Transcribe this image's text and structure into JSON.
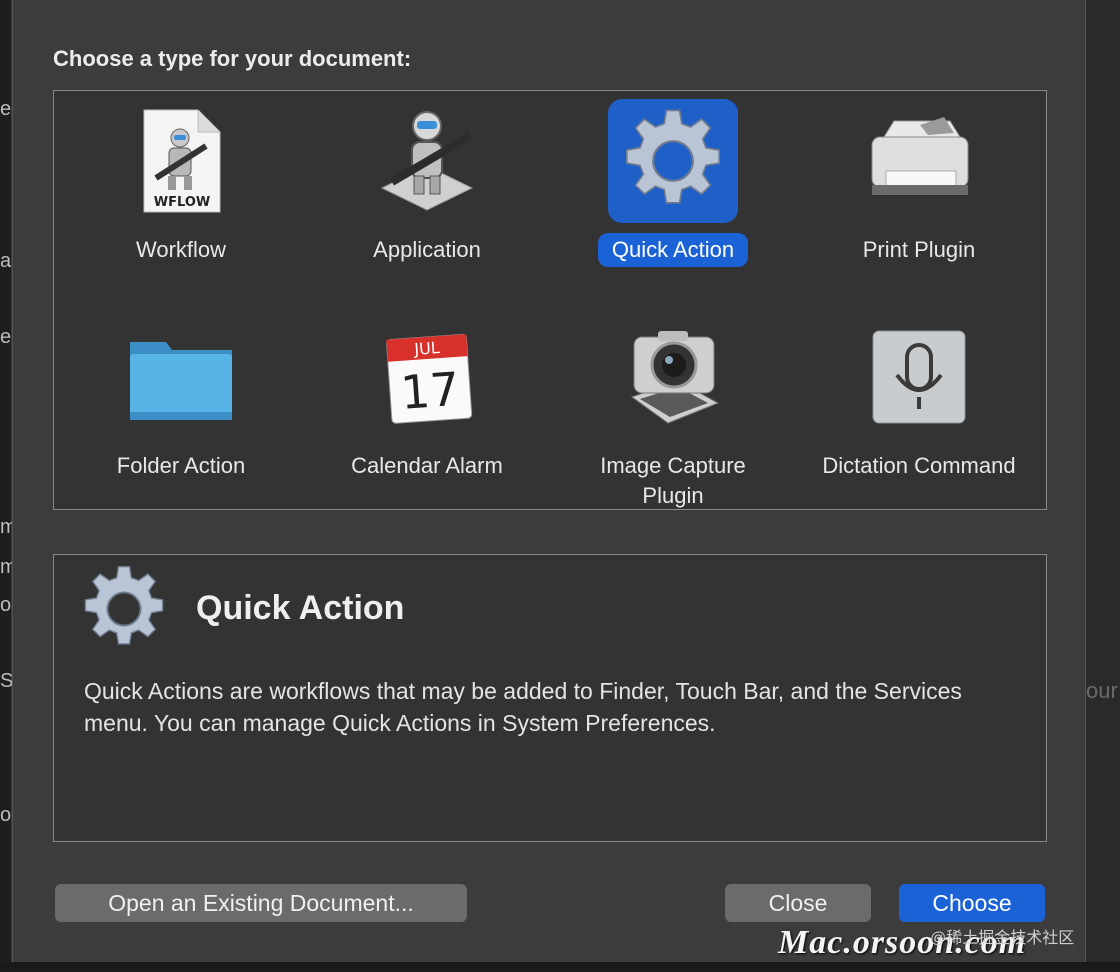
{
  "dialog": {
    "prompt": "Choose a type for your document:",
    "types": [
      {
        "label": "Workflow",
        "icon": "workflow-document-icon",
        "badge": "WFLOW",
        "selected": false
      },
      {
        "label": "Application",
        "icon": "automator-robot-icon",
        "selected": false
      },
      {
        "label": "Quick Action",
        "icon": "gear-icon",
        "selected": true
      },
      {
        "label": "Print Plugin",
        "icon": "printer-icon",
        "selected": false
      },
      {
        "label": "Folder Action",
        "icon": "folder-icon",
        "selected": false
      },
      {
        "label": "Calendar Alarm",
        "icon": "calendar-icon",
        "month": "JUL",
        "day": "17",
        "selected": false
      },
      {
        "label": "Image Capture Plugin",
        "icon": "camera-icon",
        "selected": false
      },
      {
        "label": "Dictation Command",
        "icon": "microphone-icon",
        "selected": false
      }
    ],
    "description": {
      "title": "Quick Action",
      "text": "Quick Actions are workflows that may be added to Finder, Touch Bar, and the Services menu. You can manage Quick Actions in System Preferences."
    },
    "buttons": {
      "open": "Open an Existing Document...",
      "close": "Close",
      "choose": "Choose"
    }
  },
  "background": {
    "left_fragments": [
      "e",
      "a",
      "e",
      "m",
      "m",
      "o",
      "S",
      "o"
    ],
    "right_fragment": "our"
  },
  "watermark": {
    "text": "Mac.orsoon.com",
    "secondary": "@稀土掘金技术社区"
  },
  "colors": {
    "accent": "#1b62d6",
    "sheet": "#3c3c3c",
    "panel": "#333333",
    "button": "#6b6b6b"
  }
}
